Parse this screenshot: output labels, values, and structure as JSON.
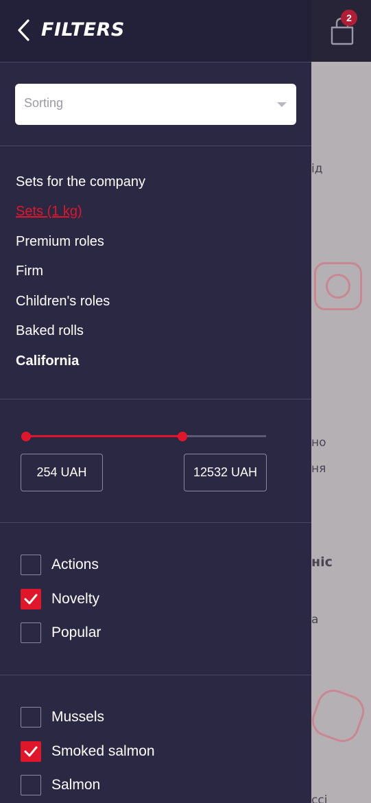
{
  "header": {
    "title": "FILTERS",
    "cart_count": "2"
  },
  "sorting": {
    "placeholder": "Sorting"
  },
  "categories": [
    {
      "label": "Sets for the company",
      "state": "normal"
    },
    {
      "label": "Sets (1 kg)",
      "state": "active"
    },
    {
      "label": "Premium roles",
      "state": "normal"
    },
    {
      "label": "Firm",
      "state": "normal"
    },
    {
      "label": "Children's roles",
      "state": "normal"
    },
    {
      "label": "Baked rolls",
      "state": "normal"
    },
    {
      "label": "California",
      "state": "bold"
    }
  ],
  "price": {
    "min_label": "254 UAH",
    "max_label": "12532 UAH",
    "range_fill_fraction": 0.65
  },
  "flags": [
    {
      "label": "Actions",
      "checked": false
    },
    {
      "label": "Novelty",
      "checked": true
    },
    {
      "label": "Popular",
      "checked": false
    }
  ],
  "ingredients": [
    {
      "label": "Mussels",
      "checked": false
    },
    {
      "label": "Smoked salmon",
      "checked": true
    },
    {
      "label": "Salmon",
      "checked": false
    }
  ],
  "background_fragments": [
    "ід",
    "но",
    "ня",
    "ніс",
    "а",
    "ссі"
  ],
  "colors": {
    "accent": "#e0172b",
    "panel": "#2b2844",
    "header": "#23213a"
  }
}
